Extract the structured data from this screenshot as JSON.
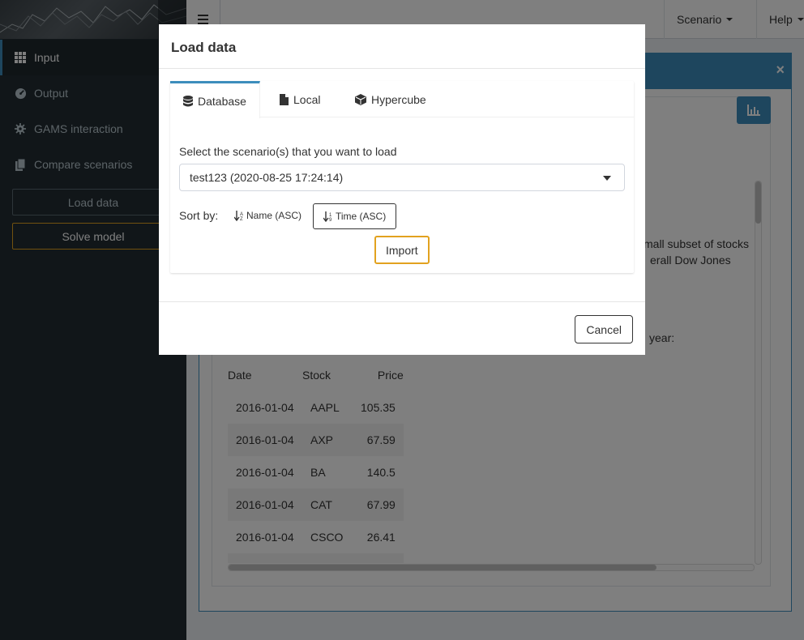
{
  "header": {
    "scenario_label": "Scenario",
    "help_label": "Help"
  },
  "sidebar": {
    "items": [
      {
        "label": "Input",
        "icon": "grid-icon",
        "active": true
      },
      {
        "label": "Output",
        "icon": "dashboard-icon",
        "active": false
      },
      {
        "label": "GAMS interaction",
        "icon": "gear-icon",
        "active": false
      },
      {
        "label": "Compare scenarios",
        "icon": "copy-icon",
        "active": false
      }
    ],
    "load_data_label": "Load data",
    "solve_model_label": "Solve model"
  },
  "main": {
    "description_line1": "mall subset of stocks",
    "description_line2": "erall Dow Jones",
    "description_line3": "year:",
    "table": {
      "columns": [
        "Date",
        "Stock",
        "Price"
      ],
      "rows": [
        [
          "2016-01-04",
          "AAPL",
          "105.35"
        ],
        [
          "2016-01-04",
          "AXP",
          "67.59"
        ],
        [
          "2016-01-04",
          "BA",
          "140.5"
        ],
        [
          "2016-01-04",
          "CAT",
          "67.99"
        ],
        [
          "2016-01-04",
          "CSCO",
          "26.41"
        ]
      ]
    }
  },
  "modal": {
    "title": "Load data",
    "tabs": [
      {
        "label": "Database",
        "icon": "database-icon",
        "active": true
      },
      {
        "label": "Local",
        "icon": "file-icon",
        "active": false
      },
      {
        "label": "Hypercube",
        "icon": "cube-icon",
        "active": false
      }
    ],
    "select_label": "Select the scenario(s) that you want to load",
    "selected_scenario": "test123 (2020-08-25 17:24:14)",
    "sort_label": "Sort by:",
    "sort_name_label": "Name (ASC)",
    "sort_time_label": "Time (ASC)",
    "import_label": "Import",
    "cancel_label": "Cancel"
  },
  "colors": {
    "primary": "#3c8dbc",
    "sidebar_bg": "#222d32",
    "accent_orange": "#e2a21f"
  }
}
